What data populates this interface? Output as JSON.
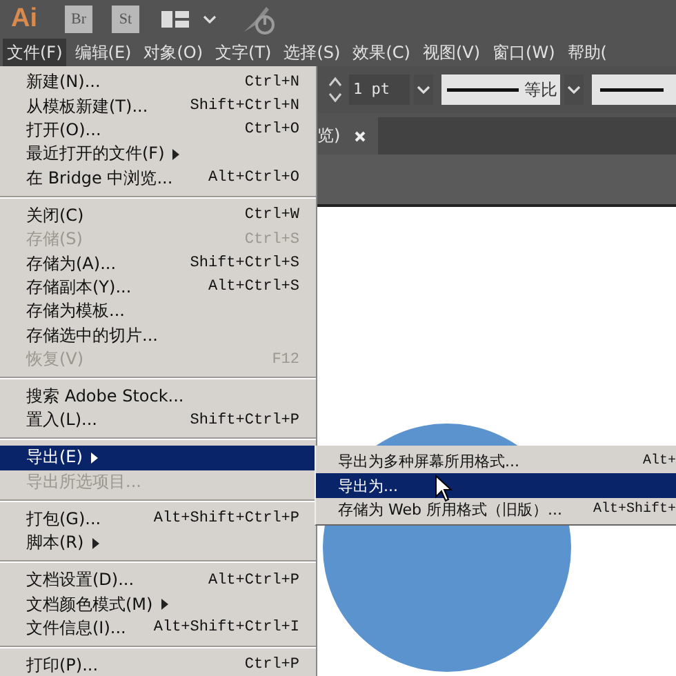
{
  "app_bar": {
    "logo": "Ai",
    "bridges": [
      "Br",
      "St"
    ]
  },
  "menu_bar": [
    {
      "label": "文件(F)",
      "selected": true
    },
    {
      "label": "编辑(E)",
      "selected": false
    },
    {
      "label": "对象(O)",
      "selected": false
    },
    {
      "label": "文字(T)",
      "selected": false
    },
    {
      "label": "选择(S)",
      "selected": false
    },
    {
      "label": "效果(C)",
      "selected": false
    },
    {
      "label": "视图(V)",
      "selected": false
    },
    {
      "label": "窗口(W)",
      "selected": false
    },
    {
      "label": "帮助(",
      "selected": false
    }
  ],
  "control_bar": {
    "stroke_weight": "1 pt",
    "profile": "等比"
  },
  "document_tab": {
    "title": "览)"
  },
  "file_menu": {
    "items": [
      {
        "kind": "item",
        "label": "新建(N)...",
        "shortcut": "Ctrl+N",
        "submenu": false,
        "disabled": false,
        "selected": false
      },
      {
        "kind": "item",
        "label": "从模板新建(T)...",
        "shortcut": "Shift+Ctrl+N",
        "submenu": false,
        "disabled": false,
        "selected": false
      },
      {
        "kind": "item",
        "label": "打开(O)...",
        "shortcut": "Ctrl+O",
        "submenu": false,
        "disabled": false,
        "selected": false
      },
      {
        "kind": "item",
        "label": "最近打开的文件(F)",
        "submenu": true,
        "disabled": false,
        "selected": false
      },
      {
        "kind": "item",
        "label": "在 Bridge 中浏览...",
        "shortcut": "Alt+Ctrl+O",
        "submenu": false,
        "disabled": false,
        "selected": false
      },
      {
        "kind": "separator"
      },
      {
        "kind": "item",
        "label": "关闭(C)",
        "shortcut": "Ctrl+W",
        "submenu": false,
        "disabled": false,
        "selected": false
      },
      {
        "kind": "item",
        "label": "存储(S)",
        "shortcut": "Ctrl+S",
        "submenu": false,
        "disabled": true,
        "selected": false
      },
      {
        "kind": "item",
        "label": "存储为(A)...",
        "shortcut": "Shift+Ctrl+S",
        "submenu": false,
        "disabled": false,
        "selected": false
      },
      {
        "kind": "item",
        "label": "存储副本(Y)...",
        "shortcut": "Alt+Ctrl+S",
        "submenu": false,
        "disabled": false,
        "selected": false
      },
      {
        "kind": "item",
        "label": "存储为模板...",
        "submenu": false,
        "disabled": false,
        "selected": false
      },
      {
        "kind": "item",
        "label": "存储选中的切片...",
        "submenu": false,
        "disabled": false,
        "selected": false
      },
      {
        "kind": "item",
        "label": "恢复(V)",
        "shortcut": "F12",
        "submenu": false,
        "disabled": true,
        "selected": false
      },
      {
        "kind": "separator"
      },
      {
        "kind": "item",
        "label": "搜索 Adobe Stock...",
        "submenu": false,
        "disabled": false,
        "selected": false
      },
      {
        "kind": "item",
        "label": "置入(L)...",
        "shortcut": "Shift+Ctrl+P",
        "submenu": false,
        "disabled": false,
        "selected": false
      },
      {
        "kind": "separator"
      },
      {
        "kind": "item",
        "label": "导出(E)",
        "submenu": true,
        "disabled": false,
        "selected": true
      },
      {
        "kind": "item",
        "label": "导出所选项目...",
        "submenu": false,
        "disabled": true,
        "selected": false
      },
      {
        "kind": "separator"
      },
      {
        "kind": "item",
        "label": "打包(G)...",
        "shortcut": "Alt+Shift+Ctrl+P",
        "submenu": false,
        "disabled": false,
        "selected": false
      },
      {
        "kind": "item",
        "label": "脚本(R)",
        "submenu": true,
        "disabled": false,
        "selected": false
      },
      {
        "kind": "separator"
      },
      {
        "kind": "item",
        "label": "文档设置(D)...",
        "shortcut": "Alt+Ctrl+P",
        "submenu": false,
        "disabled": false,
        "selected": false
      },
      {
        "kind": "item",
        "label": "文档颜色模式(M)",
        "submenu": true,
        "disabled": false,
        "selected": false
      },
      {
        "kind": "item",
        "label": "文件信息(I)...",
        "shortcut": "Alt+Shift+Ctrl+I",
        "submenu": false,
        "disabled": false,
        "selected": false
      },
      {
        "kind": "separator"
      },
      {
        "kind": "item",
        "label": "打印(P)...",
        "shortcut": "Ctrl+P",
        "submenu": false,
        "disabled": false,
        "selected": false
      }
    ]
  },
  "export_submenu": {
    "items": [
      {
        "kind": "item",
        "label": "导出为多种屏幕所用格式...",
        "shortcut": "Alt+",
        "submenu": false,
        "disabled": false,
        "selected": false
      },
      {
        "kind": "item",
        "label": "导出为...",
        "submenu": false,
        "disabled": false,
        "selected": true
      },
      {
        "kind": "item",
        "label": "存储为 Web 所用格式（旧版）...",
        "shortcut": "Alt+Shift+",
        "submenu": false,
        "disabled": false,
        "selected": false
      }
    ]
  }
}
